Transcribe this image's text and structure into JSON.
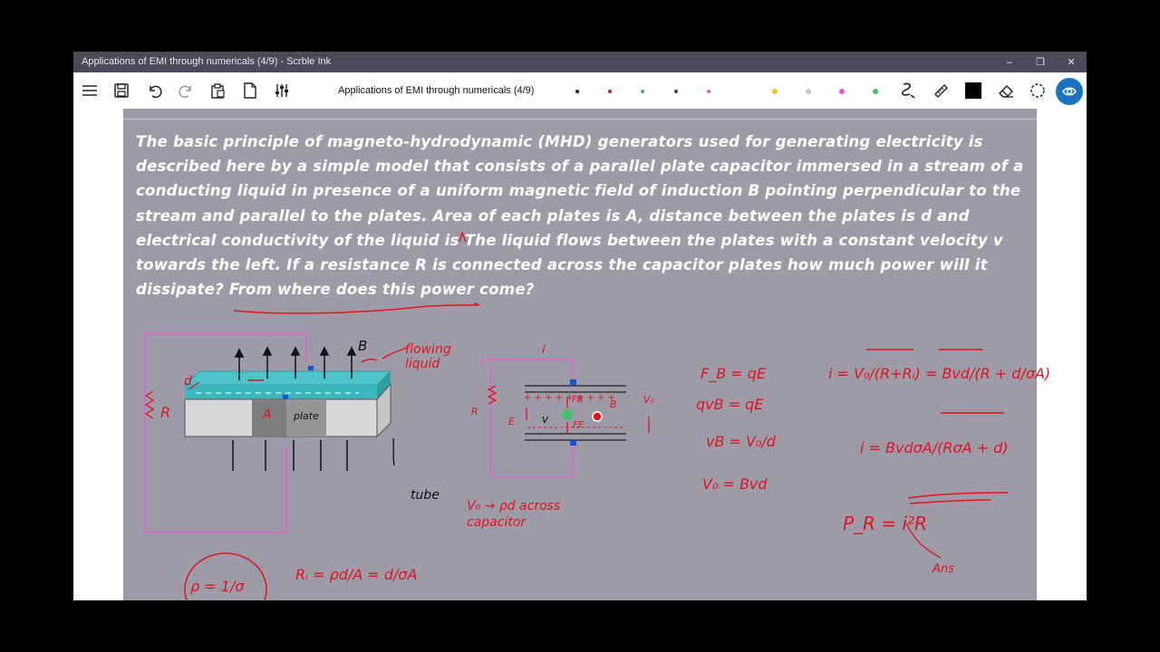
{
  "window": {
    "title": "Applications of EMI through numericals (4/9) - Scrble Ink",
    "controls": {
      "minimize": "–",
      "restore": "❐",
      "close": "✕"
    }
  },
  "toolbar": {
    "document_title": "Applications of EMI through numericals (4/9)",
    "icons": [
      "menu-icon",
      "save-icon",
      "undo-icon",
      "redo-icon",
      "paste-icon",
      "page-icon",
      "settings-sliders-icon",
      "pen-icon",
      "ruler-icon",
      "color-swatch-icon",
      "eraser-icon",
      "lasso-icon",
      "view-icon"
    ],
    "pen_colors": [
      "#222222",
      "#c01830",
      "#3fae4a",
      "#444444",
      "#e85aa8",
      "#f2c31a",
      "#c8c8c8",
      "#e356d6",
      "#3ec45a"
    ],
    "active_color": "#000000",
    "accent": "#1a73c0"
  },
  "problem_text": "The basic principle of magneto-hydrodynamic (MHD) generators used for generating electricity is described here by a simple model that consists of a parallel plate capacitor immersed in a stream of a conducting liquid in presence of a uniform magnetic field of induction B pointing perpendicular to the stream and parallel to the plates. Area of each plates is A, distance between the plates is d and electrical conductivity of the liquid is The liquid flows between the plates with a constant velocity v towards the left. If a resistance R is connected across the capacitor plates how much power will it dissipate? From where does this power come?",
  "handwriting": {
    "label_B": "B",
    "label_R": "R",
    "label_d": "d",
    "label_A": "A",
    "label_plate": "plate",
    "label_tube": "tube",
    "flowing_liquid": "flowing liquid",
    "cap_R": "R",
    "cap_E": "E",
    "cap_v": "v",
    "cap_FB": "FB",
    "cap_FE": "FE",
    "cap_B": "B",
    "cap_v0": "V₀",
    "cap_i": "i",
    "v0_note": "V₀ → ρd across capacitor",
    "rho_circle": "ρ = 1/σ",
    "internal_resistance": "Rᵢ = ρd/A = d/σA",
    "eq1": "F_B = qE",
    "eq2": "qvB = qE",
    "eq3": "vB = V₀/d",
    "eq4": "V₀ = Bvd",
    "current1": "i = V₀/(R+Rᵢ) = Bvd/(R + d/σA)",
    "current2": "i = BvdσA/(RσA + d)",
    "power": "P_R = i²R",
    "ans": "Ans"
  }
}
